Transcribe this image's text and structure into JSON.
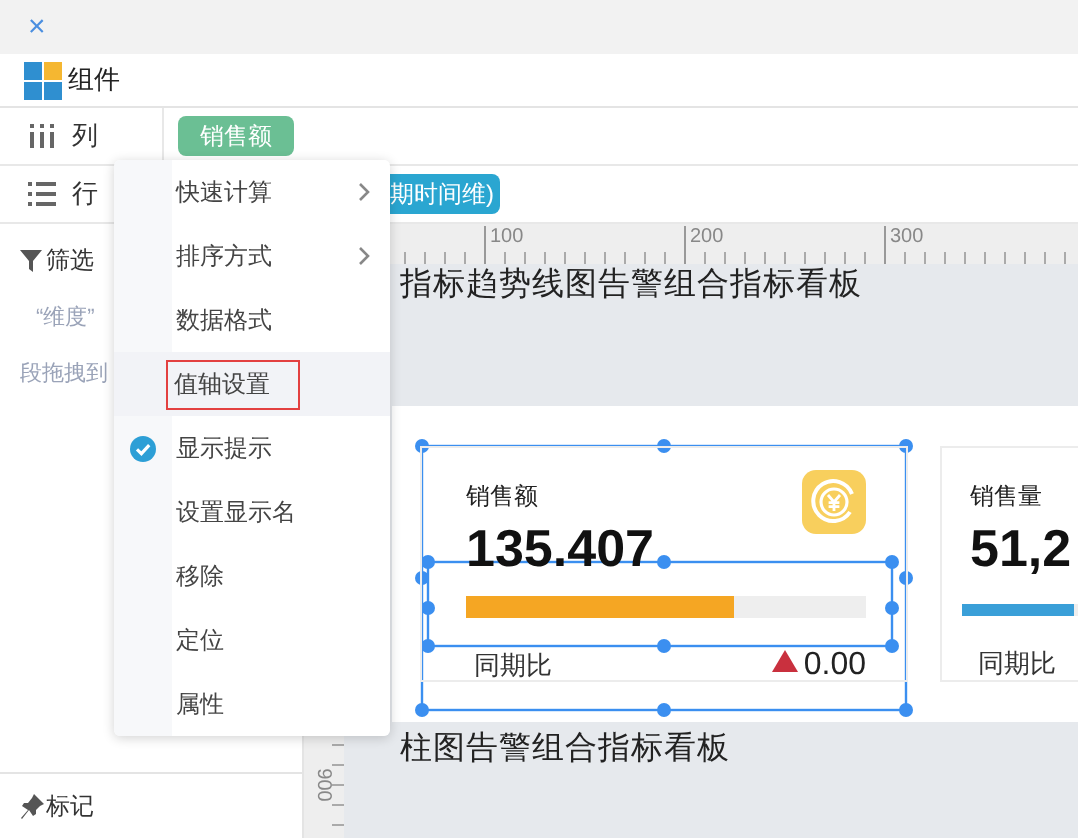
{
  "window": {
    "close": "×"
  },
  "toolbar": {
    "title": "组件"
  },
  "shelves": [
    {
      "kind": "columns",
      "label": "列",
      "pills": [
        {
          "text": "销售额",
          "color": "#6bbf94",
          "clipped": false
        }
      ]
    },
    {
      "kind": "rows",
      "label": "行",
      "pills": [
        {
          "text": "期时间维)",
          "color": "#2aa6d1",
          "clipped": true
        }
      ]
    }
  ],
  "sidebar": {
    "filter": {
      "label": "筛选",
      "texts": [
        "“维度”",
        "段拖拽到"
      ]
    },
    "marks": {
      "label": "标记"
    }
  },
  "ruler": {
    "xticks": [
      "100",
      "200",
      "300"
    ],
    "yticks": [
      "900"
    ]
  },
  "canvas": {
    "titles": [
      "指标趋势线图告警组合指标看板",
      "柱图告警组合指标看板"
    ],
    "cards": [
      {
        "kind": "with-icon",
        "label": "销售额",
        "value": "135.407",
        "level": 0.67,
        "color": "#f5a623",
        "compare_label": "同期比",
        "compare_value": "0.00",
        "selected": true
      },
      {
        "kind": "plain",
        "label": "销售量",
        "value": "51,2",
        "level": 0.8,
        "color": "#3a9fd8",
        "compare_label": "同期比",
        "selected": false
      }
    ]
  },
  "menu": {
    "items": [
      {
        "label": "快速计算",
        "submenu": true,
        "checked": false,
        "selected": false
      },
      {
        "label": "排序方式",
        "submenu": true,
        "checked": false,
        "selected": false
      },
      {
        "label": "数据格式",
        "submenu": false,
        "checked": false,
        "selected": false
      },
      {
        "label": "值轴设置",
        "submenu": false,
        "checked": false,
        "selected": true
      },
      {
        "label": "显示提示",
        "submenu": false,
        "checked": true,
        "selected": false
      },
      {
        "label": "设置显示名",
        "submenu": false,
        "checked": false,
        "selected": false
      },
      {
        "label": "移除",
        "submenu": false,
        "checked": false,
        "selected": false
      },
      {
        "label": "定位",
        "submenu": false,
        "checked": false,
        "selected": false
      },
      {
        "label": "属性",
        "submenu": false,
        "checked": false,
        "selected": false
      }
    ]
  }
}
